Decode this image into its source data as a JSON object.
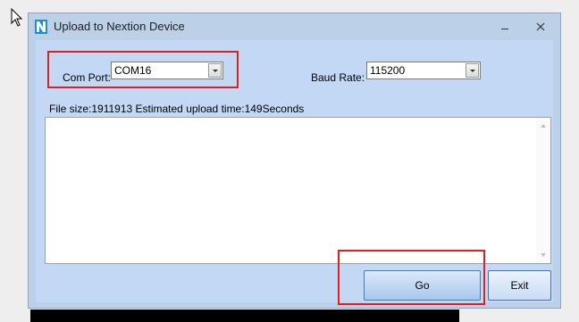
{
  "window": {
    "title": "Upload to Nextion Device",
    "min_glyph": "–",
    "close_glyph": "✕"
  },
  "form": {
    "com_port_label": "Com Port:",
    "com_port_value": "COM16",
    "baud_rate_label": "Baud Rate:",
    "baud_rate_value": "115200",
    "file_info": "File size:1911913 Estimated upload time:149Seconds",
    "log_text": ""
  },
  "buttons": {
    "go_label": "Go",
    "exit_label": "Exit"
  },
  "annotations": {
    "highlight_color": "#e02020"
  },
  "icons": {
    "app": "nextion-logo-icon",
    "minimize": "minimize-icon",
    "close": "close-icon",
    "dropdown": "chevron-down-icon",
    "cursor": "mouse-pointer-icon"
  }
}
